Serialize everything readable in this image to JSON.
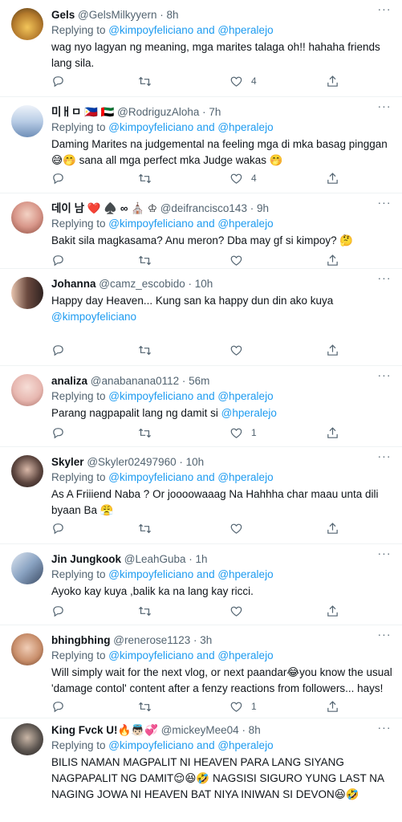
{
  "replying_prefix": "Replying to ",
  "and_text": " and ",
  "tweets": [
    {
      "name": "Gels",
      "handle": "@GelsMilkyyern · 8h",
      "reply_to": [
        "@kimpoyfeliciano",
        "@hperalejo"
      ],
      "text": "wag nyo lagyan ng meaning, mga marites talaga oh!! hahaha friends lang sila.",
      "likes": "4",
      "avatar_color": "#c9a04a"
    },
    {
      "name": "미ㅐㅁ 🇵🇭 🇦🇪",
      "handle": "@RodriguzAloha · 7h",
      "reply_to": [
        "@kimpoyfeliciano",
        "@hperalejo"
      ],
      "text": "Daming Marites na judgemental na feeling mga di mka basag pinggan 😅🤭 sana all mga perfect mka Judge wakas 🤭",
      "likes": "4",
      "avatar_color": "#9fb8d8"
    },
    {
      "name": "데이 남 ❤️ ♠️ ∞ ⛪ ♔",
      "handle": "@deifrancisco143 · 9h",
      "reply_to": [],
      "text": "Bakit sila magkasama? Anu meron? Dba may gf si kimpoy? 🤔",
      "likes": "",
      "avatar_color": "#d89a8f"
    },
    {
      "name": "Johanna",
      "handle": "@camz_escobido · 10h",
      "reply_to": [],
      "text": "Happy  day Heaven... Kung san ka happy dun din ako kuya",
      "text_mention": "@kimpoyfeliciano",
      "likes": "",
      "avatar_color": "#6b4a3f"
    },
    {
      "name": "analiza",
      "handle": "@anabanana0112 · 56m",
      "reply_to": [
        "@kimpoyfeliciano",
        "@hperalejo"
      ],
      "text": "Parang nagpapalit lang ng damit si ",
      "text_mention": "@hperalejo",
      "likes": "1",
      "avatar_color": "#e7b7b0"
    },
    {
      "name": "Skyler",
      "handle": "@Skyler02497960 · 10h",
      "reply_to": [
        "@kimpoyfeliciano",
        "@hperalejo"
      ],
      "text": "As A Friiiend Naba ? Or joooowaaag Na Hahhha char maau unta dili byaan Ba 😤",
      "likes": "",
      "avatar_color": "#3c2f2c"
    },
    {
      "name": "Jin Jungkook",
      "handle": "@LeahGuba · 1h",
      "reply_to": [
        "@kimpoyfeliciano",
        "@hperalejo"
      ],
      "text": "Ayoko kay kuya ,balik ka na lang kay ricci.",
      "likes": "",
      "avatar_color": "#8aa3c2"
    },
    {
      "name": "bhingbhing",
      "handle": "@renerose1123 · 3h",
      "reply_to": [
        "@kimpoyfeliciano",
        "@hperalejo"
      ],
      "text": "Will simply wait for the next vlog, or next paandar😂you know the usual 'damage contol' content after a fenzy reactions from followers... hays!",
      "likes": "1",
      "avatar_color": "#d6a484"
    },
    {
      "name": "King Fvck U!🔥👼🏻💞",
      "handle": "@mickeyMee04 · 8h",
      "reply_to": [
        "@kimpoyfeliciano",
        "@hperalejo"
      ],
      "text": "BILIS NAMAN MAGPALIT NI HEAVEN PARA LANG SIYANG NAGPAPALIT NG DAMIT😌😆🤣 NAGSISI SIGURO YUNG LAST NA NAGING JOWA NI HEAVEN BAT NIYA INIWAN SI DEVON😆🤣",
      "likes": "",
      "avatar_color": "#5c5550"
    }
  ]
}
